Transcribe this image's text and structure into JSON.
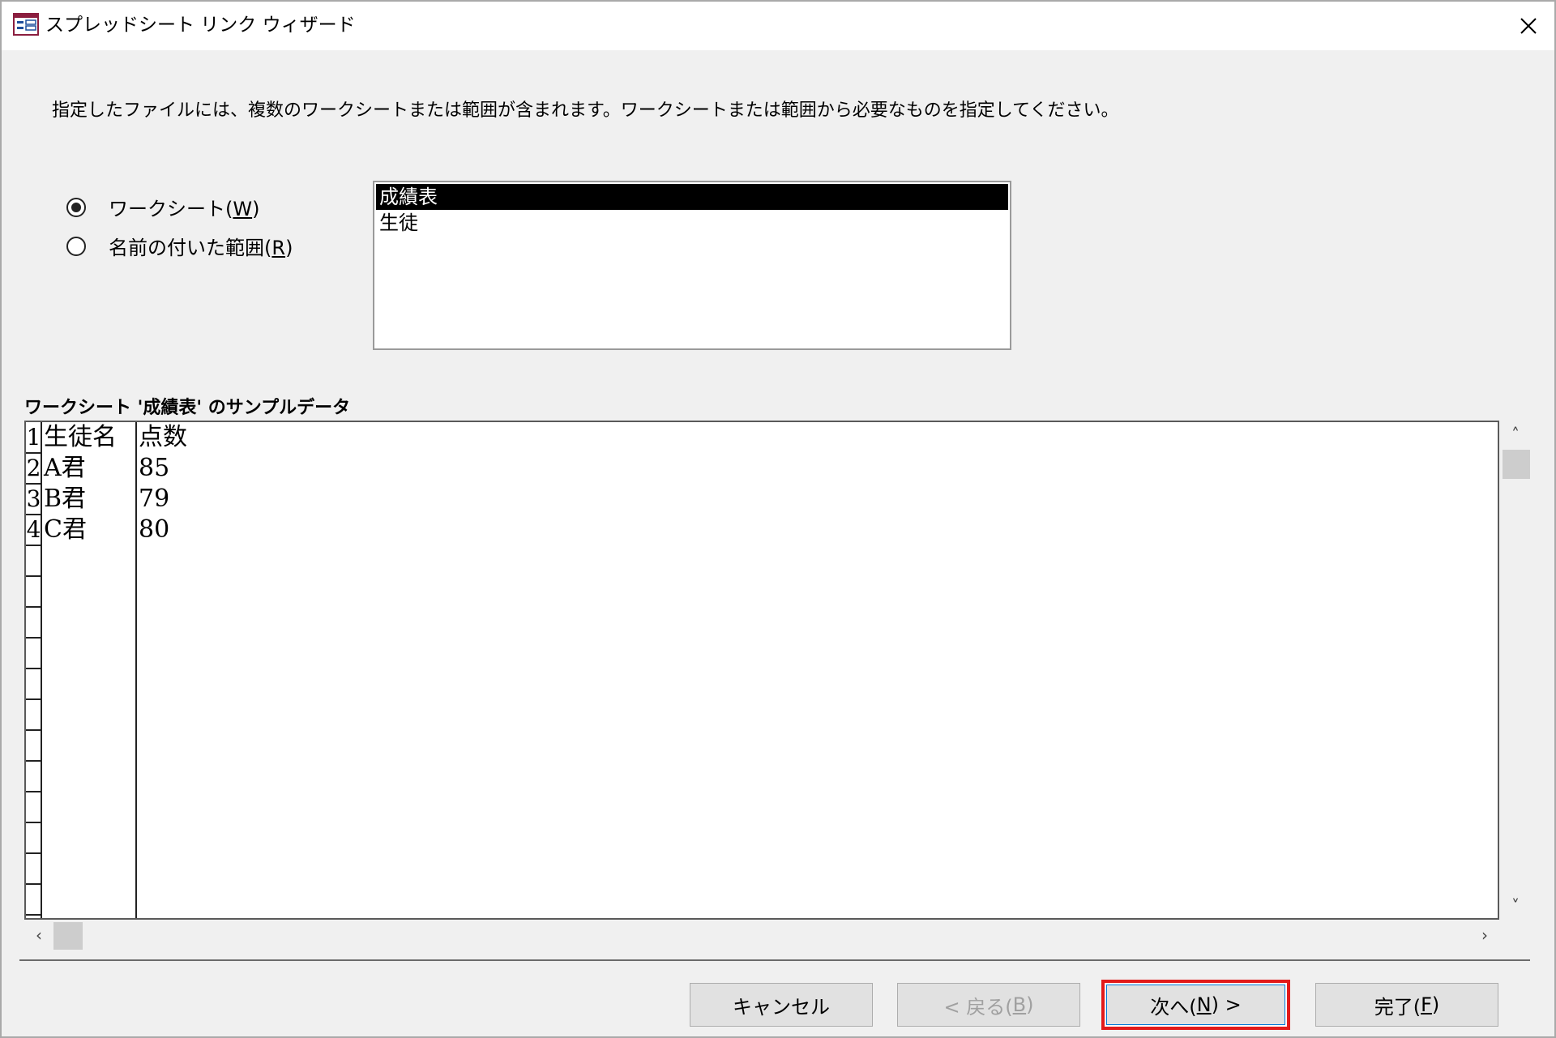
{
  "window": {
    "title": "スプレッドシート リンク ウィザード"
  },
  "instruction": "指定したファイルには、複数のワークシートまたは範囲が含まれます。ワークシートまたは範囲から必要なものを指定してください。",
  "radios": {
    "worksheet": {
      "label_prefix": "ワークシート(",
      "accel": "W",
      "label_suffix": ")",
      "selected": true
    },
    "named_range": {
      "label_prefix": "名前の付いた範囲(",
      "accel": "R",
      "label_suffix": ")",
      "selected": false
    }
  },
  "sheet_list": {
    "items": [
      "成績表",
      "生徒"
    ],
    "selected_index": 0
  },
  "sample": {
    "label": "ワークシート '成績表' のサンプルデータ",
    "rows": [
      {
        "num": "1",
        "a": "生徒名",
        "b": "点数"
      },
      {
        "num": "2",
        "a": "A君",
        "b": "85"
      },
      {
        "num": "3",
        "a": "B君",
        "b": "79"
      },
      {
        "num": "4",
        "a": "C君",
        "b": "80"
      }
    ]
  },
  "buttons": {
    "cancel": "キャンセル",
    "back_prefix": "< 戻る(",
    "back_accel": "B",
    "back_suffix": ")",
    "next_prefix": "次へ(",
    "next_accel": "N",
    "next_suffix": ") >",
    "finish_prefix": "完了(",
    "finish_accel": "F",
    "finish_suffix": ")"
  },
  "colors": {
    "highlight_box": "#e21a1a",
    "selection_bg": "#000000",
    "dialog_bg": "#f0f0f0"
  }
}
